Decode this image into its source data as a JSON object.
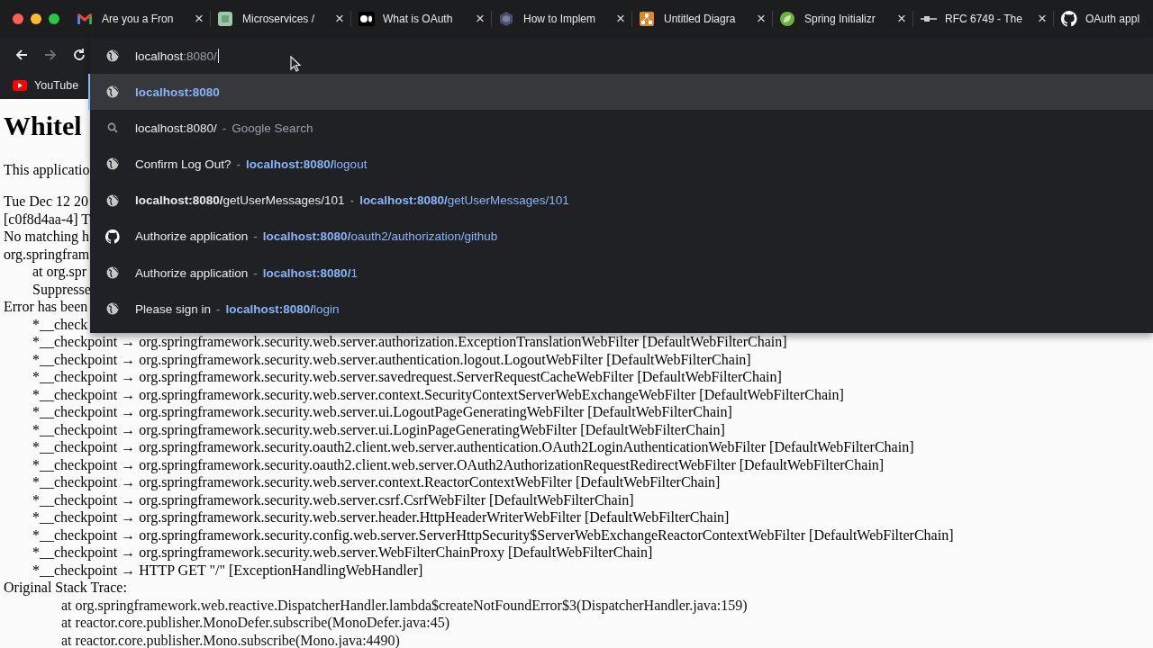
{
  "tabs": [
    {
      "title": "Are you a Fron",
      "close": "×"
    },
    {
      "title": "Microservices /",
      "close": "×"
    },
    {
      "title": "What is OAuth",
      "close": "×"
    },
    {
      "title": "How to Implem",
      "close": "×"
    },
    {
      "title": "Untitled Diagra",
      "close": "×"
    },
    {
      "title": "Spring Initializr",
      "close": "×"
    },
    {
      "title": "RFC 6749 - The",
      "close": "×"
    },
    {
      "title": "OAuth appl"
    }
  ],
  "toolbar": {
    "buttons": [
      {
        "kind": "back",
        "disabled": false
      },
      {
        "kind": "forward",
        "disabled": true
      },
      {
        "kind": "reload",
        "disabled": false
      }
    ],
    "address": {
      "host": "localhost",
      "rest": ":8080/"
    }
  },
  "bookmarks": [
    {
      "label": "YouTube"
    }
  ],
  "suggestions": [
    {
      "url": "**localhost:8080**",
      "selected": true
    },
    {
      "title": "localhost:8080/",
      "separator": "-",
      "hint": "Google Search",
      "selected": false
    },
    {
      "title": "Confirm Log Out?",
      "separator": "-",
      "url": "**localhost:8080/**logout",
      "selected": false
    },
    {
      "title": "**localhost:8080/**getUserMessages/101",
      "separator": "-",
      "url": "**localhost:8080/**getUserMessages/101",
      "selected": false
    },
    {
      "title": "Authorize application",
      "separator": "-",
      "url": "**localhost:8080/**oauth2/authorization/github",
      "selected": false
    },
    {
      "title": "Authorize application",
      "separator": "-",
      "url": "**localhost:8080/**1",
      "selected": false
    },
    {
      "title": "Please sign in",
      "separator": "-",
      "url": "**localhost:8080/**login",
      "selected": false
    }
  ],
  "page": {
    "heading": "Whitel",
    "intro": "This applicatio",
    "log": [
      {
        "kind": "text",
        "text": "Tue Dec 12 20"
      },
      {
        "kind": "text",
        "text": "[c0f8d4aa-4] T"
      },
      {
        "kind": "text",
        "text": "No matching h"
      },
      {
        "kind": "text",
        "text": "org.springfram",
        "children": [
          {
            "kind": "text",
            "text": "at org.spr"
          },
          {
            "kind": "text",
            "text": "Suppresse"
          }
        ]
      },
      {
        "kind": "text",
        "text": "Error has been",
        "children": [
          {
            "kind": "text",
            "text": "*__check"
          },
          {
            "kind": "text",
            "text": "*__checkpoint → org.springframework.security.web.server.authorization.ExceptionTranslationWebFilter [DefaultWebFilterChain]"
          },
          {
            "kind": "text",
            "text": "*__checkpoint → org.springframework.security.web.server.authentication.logout.LogoutWebFilter [DefaultWebFilterChain]"
          },
          {
            "kind": "text",
            "text": "*__checkpoint → org.springframework.security.web.server.savedrequest.ServerRequestCacheWebFilter [DefaultWebFilterChain]"
          },
          {
            "kind": "text",
            "text": "*__checkpoint → org.springframework.security.web.server.context.SecurityContextServerWebExchangeWebFilter [DefaultWebFilterChain]"
          },
          {
            "kind": "text",
            "text": "*__checkpoint → org.springframework.security.web.server.ui.LogoutPageGeneratingWebFilter [DefaultWebFilterChain]"
          },
          {
            "kind": "text",
            "text": "*__checkpoint → org.springframework.security.web.server.ui.LoginPageGeneratingWebFilter [DefaultWebFilterChain]"
          },
          {
            "kind": "text",
            "text": "*__checkpoint → org.springframework.security.oauth2.client.web.server.authentication.OAuth2LoginAuthenticationWebFilter [DefaultWebFilterChain]"
          },
          {
            "kind": "text",
            "text": "*__checkpoint → org.springframework.security.oauth2.client.web.server.OAuth2AuthorizationRequestRedirectWebFilter [DefaultWebFilterChain]"
          },
          {
            "kind": "text",
            "text": "*__checkpoint → org.springframework.security.web.server.context.ReactorContextWebFilter [DefaultWebFilterChain]"
          },
          {
            "kind": "text",
            "text": "*__checkpoint → org.springframework.security.web.server.csrf.CsrfWebFilter [DefaultWebFilterChain]"
          },
          {
            "kind": "text",
            "text": "*__checkpoint → org.springframework.security.web.server.header.HttpHeaderWriterWebFilter [DefaultWebFilterChain]"
          },
          {
            "kind": "text",
            "text": "*__checkpoint → org.springframework.security.config.web.server.ServerHttpSecurity$ServerWebExchangeReactorContextWebFilter [DefaultWebFilterChain]"
          },
          {
            "kind": "text",
            "text": "*__checkpoint → org.springframework.security.web.server.WebFilterChainProxy [DefaultWebFilterChain]"
          },
          {
            "kind": "text",
            "text": "*__checkpoint → HTTP GET \"/\" [ExceptionHandlingWebHandler]"
          }
        ]
      },
      {
        "kind": "text",
        "text": "Original Stack Trace:",
        "children": [
          {
            "kind": "frame",
            "text": "at org.springframework.web.reactive.DispatcherHandler.lambda$createNotFoundError$3(DispatcherHandler.java:159)"
          },
          {
            "kind": "frame",
            "text": "at reactor.core.publisher.MonoDefer.subscribe(MonoDefer.java:45)"
          },
          {
            "kind": "frame",
            "text": "at reactor.core.publisher.Mono.subscribe(Mono.java:4490)"
          }
        ]
      }
    ]
  }
}
